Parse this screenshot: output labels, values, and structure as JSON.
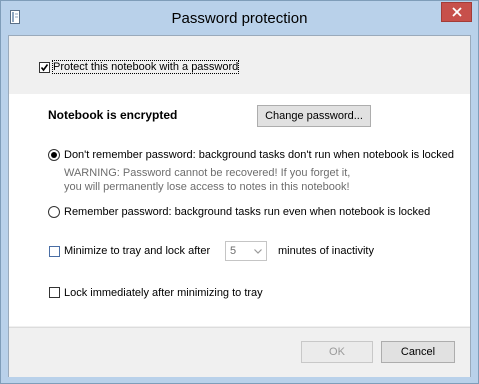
{
  "window": {
    "title": "Password protection"
  },
  "protect": {
    "label": "Protect this notebook with a password",
    "checked": true
  },
  "status": {
    "title": "Notebook is encrypted"
  },
  "buttons": {
    "change_password": "Change password...",
    "ok": "OK",
    "cancel": "Cancel"
  },
  "options": {
    "dont_remember": "Don't remember password: background tasks don't run when notebook is locked",
    "warning_line1": "WARNING: Password cannot be recovered! If you forget it,",
    "warning_line2": "you will permanently lose access to notes in this notebook!",
    "remember": "Remember password: background tasks run even when notebook is locked",
    "selected": "dont_remember"
  },
  "tray": {
    "minimize_label": "Minimize to tray and lock after",
    "minutes_value": "5",
    "minutes_suffix": "minutes of inactivity",
    "lock_immediately_label": "Lock immediately after minimizing to tray"
  },
  "colors": {
    "title_bar": "#b9d1ea",
    "close_button": "#c7504b"
  }
}
